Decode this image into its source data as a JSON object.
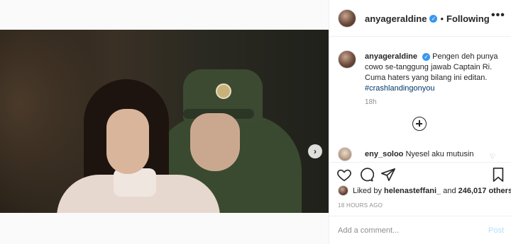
{
  "post": {
    "author": "anyageraldine",
    "follow_status": "Following",
    "separator": "•",
    "more_label": "•••",
    "caption_text": "Pengen deh punya cowo se-tanggung jawab Captain Ri. Cuma haters yang bilang ini editan.",
    "hashtag": "#crashlandingonyou",
    "caption_time": "18h",
    "comment": {
      "username": "eny_soloo",
      "text": "Nyesel aku mutusin"
    },
    "likes": {
      "prefix": "Liked by",
      "liker": "helenasteffani_",
      "connector": "and",
      "count_text": "246,017 others"
    },
    "posted_ago": "18 HOURS AGO",
    "add_comment_placeholder": "Add a comment...",
    "post_button": "Post",
    "carousel": {
      "current_index": 1,
      "total": 2
    }
  },
  "icons": {
    "verified": "verified-badge-icon",
    "heart": "heart-icon",
    "comment": "comment-icon",
    "share": "share-icon",
    "bookmark": "bookmark-icon",
    "next": "chevron-right-icon",
    "plus": "load-more-icon"
  },
  "colors": {
    "accent": "#3897f0",
    "hashtag": "#00376b",
    "muted": "#8e8e8e",
    "post_disabled": "#b2dffc"
  }
}
